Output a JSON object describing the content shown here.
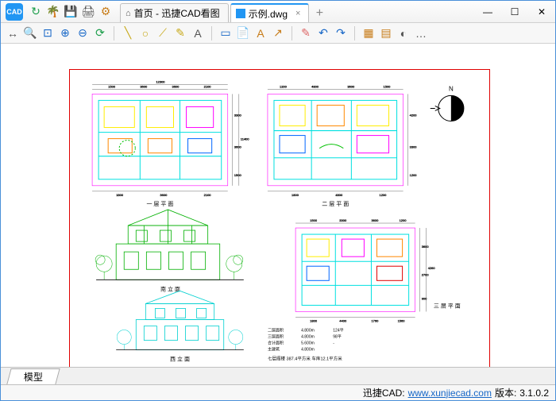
{
  "app": {
    "logo_text": "CAD"
  },
  "titlebar_icons": {
    "refresh": "↻",
    "palm": "🌴",
    "save": "💾",
    "print": "🖨",
    "settings": "⚙"
  },
  "tabs": {
    "home": {
      "icon": "⌂",
      "label": "首页 - 迅捷CAD看图"
    },
    "file": {
      "label": "示例.dwg",
      "close": "×"
    },
    "new": "+"
  },
  "window_controls": {
    "min": "—",
    "max": "☐",
    "close": "✕"
  },
  "toolbar": {
    "grp1": [
      "↔",
      "🔍",
      "⊡",
      "⊕",
      "⊖",
      "⟳"
    ],
    "grp2": [
      "╲",
      "○",
      "⟋",
      "✎",
      "A"
    ],
    "grp3": [
      "▭",
      "📄",
      "A",
      "↗"
    ],
    "grp4": [
      "✎",
      "↶",
      "↷"
    ],
    "grp5": [
      "▦",
      "▤",
      "◐",
      "…"
    ]
  },
  "drawing_labels": {
    "plan1": "一 层 平 面",
    "plan2": "二 层 平 面",
    "plan3": "三 层 平 面",
    "elev_south": "南 立 面",
    "elev_west": "西 立 面",
    "area_title": "七层阁楼   387.4平方米  车库12.1平方米",
    "table": {
      "c1": [
        "二层面积",
        "三层面积",
        "合计面积",
        "主建筑"
      ],
      "c2": [
        "4.800m",
        "4.800m",
        "5.600m",
        "4.800m"
      ],
      "c3": [
        "124平",
        "98平",
        "-",
        ""
      ]
    },
    "compass": "N"
  },
  "bottom_tab": "模型",
  "status": {
    "brand": "迅捷CAD:",
    "url": "www.xunjiecad.com",
    "version_label": "版本:",
    "version": "3.1.0.2"
  }
}
